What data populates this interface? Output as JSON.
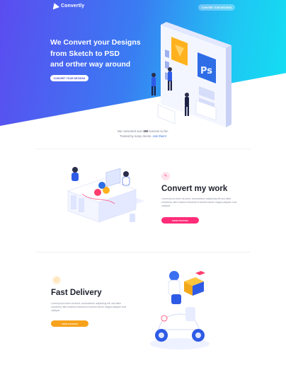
{
  "nav": {
    "logo_text": "Convertly",
    "cta": "CONVERT OUR DESIGNS"
  },
  "hero": {
    "title_lines": [
      "We Convert your Designs",
      "from Sketch to PSD",
      "and orther way around"
    ],
    "button": "CONVERT YOUR DESIGNS"
  },
  "stats": {
    "line1_prefix": "We converted over",
    "count": "300",
    "line1_suffix": "screens so far.",
    "line2_prefix": "Trusted by many clients.",
    "link": "Join them!"
  },
  "section_convert": {
    "title": "Convert my work",
    "text": "Lorem ipsum dolor sit amet, consectetuer adipiscing elit sed diam nonummy nibh euismod tincidunt ut laoreet dolore magna aliquam erat volutpat.",
    "button": "VIEW PRICING",
    "accent": "#ff2d78"
  },
  "section_delivery": {
    "title": "Fast Delivery",
    "text": "Lorem ipsum dolor sit amet, consectetuer adipiscing elit, sed diam nonummy nibh euismod tincidunt ut laoreet dolore magna aliquam erat volutpat.",
    "button": "VIEW PRICING",
    "accent": "#f7a21b"
  },
  "colors": {
    "gradient_start": "#5b4cf0",
    "gradient_end": "#12e0f2"
  }
}
